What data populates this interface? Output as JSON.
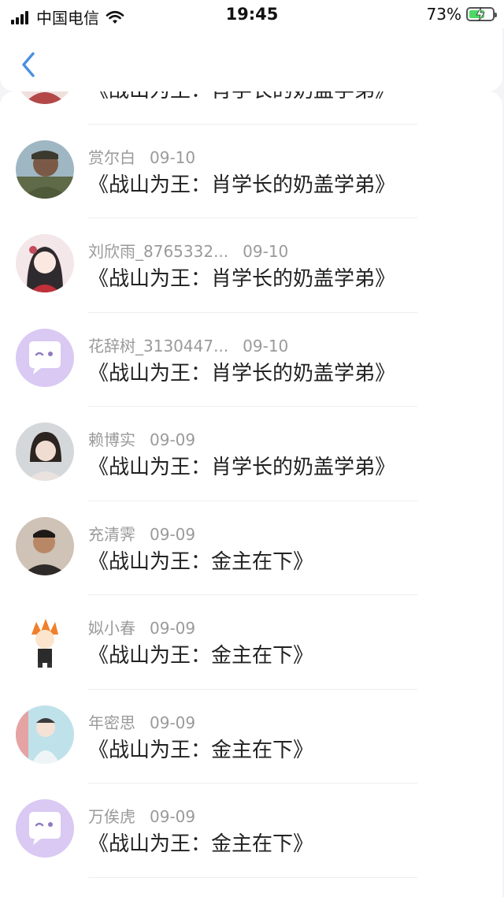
{
  "status_bar": {
    "carrier": "中国电信",
    "time": "19:45",
    "battery_percent": "73%",
    "battery_level": 0.73,
    "charging": true
  },
  "header": {
    "back_icon": "chevron-left-icon",
    "accent_color": "#4a90e2"
  },
  "items": [
    {
      "name": "",
      "date": "",
      "title": "《战山为王：肖学长的奶盖学弟》",
      "avatar": "photo"
    },
    {
      "name": "赏尔白",
      "date": "09-10",
      "title": "《战山为王：肖学长的奶盖学弟》",
      "avatar": "photo"
    },
    {
      "name": "刘欣雨_8765332...",
      "date": "09-10",
      "title": "《战山为王：肖学长的奶盖学弟》",
      "avatar": "photo"
    },
    {
      "name": "花辞树_3130447...",
      "date": "09-10",
      "title": "《战山为王：肖学长的奶盖学弟》",
      "avatar": "default-chat-icon"
    },
    {
      "name": "赖博实",
      "date": "09-09",
      "title": "《战山为王：肖学长的奶盖学弟》",
      "avatar": "photo"
    },
    {
      "name": "充清霁",
      "date": "09-09",
      "title": "《战山为王：金主在下》",
      "avatar": "photo"
    },
    {
      "name": "姒小春",
      "date": "09-09",
      "title": "《战山为王：金主在下》",
      "avatar": "photo"
    },
    {
      "name": "年密思",
      "date": "09-09",
      "title": "《战山为王：金主在下》",
      "avatar": "photo"
    },
    {
      "name": "万俟虎",
      "date": "09-09",
      "title": "《战山为王：金主在下》",
      "avatar": "default-chat-icon"
    }
  ],
  "colors": {
    "default_avatar_bg": "#d9c9f3",
    "name_text": "#9a9a9a",
    "title_text": "#222222"
  }
}
